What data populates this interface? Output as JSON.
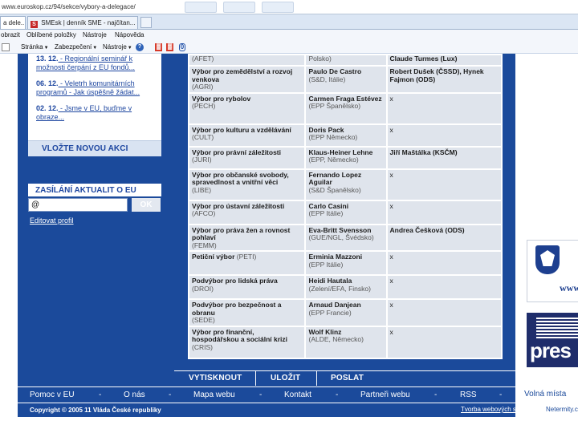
{
  "browser": {
    "url": "www.euroskop.cz/94/sekce/vybory-a-delegace/",
    "tabs": [
      {
        "label": "a dele...",
        "close": "×"
      },
      {
        "favicon": "S",
        "label": "SMEsk | denník SME - najčítan...",
        "close": "×"
      }
    ],
    "menu": [
      "obrazit",
      "Oblíbené položky",
      "Nástroje",
      "Nápověda"
    ],
    "commands": [
      {
        "label": "Stránka",
        "arrow": "▼"
      },
      {
        "label": "Zabezpečení",
        "arrow": "▼"
      },
      {
        "label": "Nástroje",
        "arrow": "▼"
      }
    ],
    "help_glyph": "?",
    "red_glyph": "▓",
    "blue_glyph": "0"
  },
  "sidebar": {
    "news": [
      {
        "date": "13. 12.",
        "text": " - Regionální seminář k možnosti čerpání z EU fondů..."
      },
      {
        "date": "06. 12.",
        "text": " - Veletrh komunitárních programů - Jak úspěšně žádat..."
      },
      {
        "date": "02. 12.",
        "text": " - Jsme v EU, buďme v obraze..."
      }
    ],
    "add_action": "VLOŽTE NOVOU AKCI",
    "subscribe_title": "ZASÍLÁNÍ AKTUALIT O EU",
    "subscribe_value": "@",
    "ok_label": "OK",
    "edit_profile": "Editovat profil"
  },
  "committees": [
    {
      "name": "(AFET)",
      "chair": "Polsko)",
      "vice": "Claude Turmes (Lux)"
    },
    {
      "name": "Výbor pro zemědělství a rozvoj venkova",
      "abbr": "(AGRI)",
      "chair": "Paulo De Castro",
      "chair_note": "(S&D, Itálie)",
      "vice": "Robert Dušek (ČSSD), Hynek Fajmon (ODS)",
      "vice_bold": true
    },
    {
      "name": "Výbor pro rybolov",
      "abbr": "(PECH)",
      "chair": "Carmen Fraga Estévez",
      "chair_note": "(EPP Španělsko)",
      "vice": "x"
    },
    {
      "name": "Výbor pro kulturu a vzdělávání",
      "abbr": "(CULT)",
      "chair": "Doris Pack",
      "chair_note": "(EPP Německo)",
      "vice": "x"
    },
    {
      "name": "Výbor pro právní záležitosti",
      "abbr": "(JURI)",
      "chair": "Klaus-Heiner Lehne",
      "chair_note": "(EPP, Německo)",
      "vice": "Jiří Maštálka (KSČM)"
    },
    {
      "name": "Výbor pro občanské svobody, spravedlnost a vnitřní věci",
      "abbr": "(LIBE)",
      "chair": "Fernando Lopez Aguilar",
      "chair_note": "(S&D Španělsko)",
      "vice": "x"
    },
    {
      "name": "Výbor pro ústavní záležitosti",
      "abbr": "(AFCO)",
      "chair": "Carlo Casini",
      "chair_note": "(EPP Itálie)",
      "vice": "x"
    },
    {
      "name": "Výbor pro práva žen a rovnost pohlaví",
      "abbr": "(FEMM)",
      "chair": "Eva-Britt Svensson",
      "chair_note": "(GUE/NGL, Švédsko)",
      "vice": "Andrea Češková (ODS)",
      "vice_bold": true
    },
    {
      "name": "Petiční výbor",
      "abbr": "(PETI)",
      "chair": "Erminia Mazzoni",
      "chair_note": "(EPP Itálie)",
      "vice": "x"
    },
    {
      "name": "Podvýbor pro lidská práva",
      "abbr": "(DROI)",
      "chair": "Heidi Hautala",
      "chair_note": "(Zelení/EFA, Finsko)",
      "vice": "x"
    },
    {
      "name": "Podvýbor pro bezpečnost a obranu",
      "abbr": "(SEDE)",
      "chair": "Arnaud Danjean",
      "chair_note": "(EPP Francie)",
      "vice": "x"
    },
    {
      "name": "Výbor pro finanční, hospodářskou a sociální krizi",
      "abbr": "(CRIS)",
      "chair": "Wolf Klinz",
      "chair_note": "(ALDE, Německo)",
      "vice": "x"
    }
  ],
  "actions": {
    "print": "VYTISKNOUT",
    "save": "ULOŽIT",
    "send": "POSLAT"
  },
  "footer": {
    "links": [
      "Pomoc v EU",
      "-",
      "O nás",
      "-",
      "Mapa webu",
      "-",
      "Kontakt",
      "-",
      "Partneři webu",
      "-",
      "RSS",
      "-",
      "Volná místa"
    ],
    "copyright": "Copyright © 2005 11 Vláda České republiky",
    "creator": "Tvorba webových stránek",
    "netermity": "Netermity.c"
  },
  "banners": {
    "banner1_text": "www",
    "banner2_text": "pres"
  }
}
